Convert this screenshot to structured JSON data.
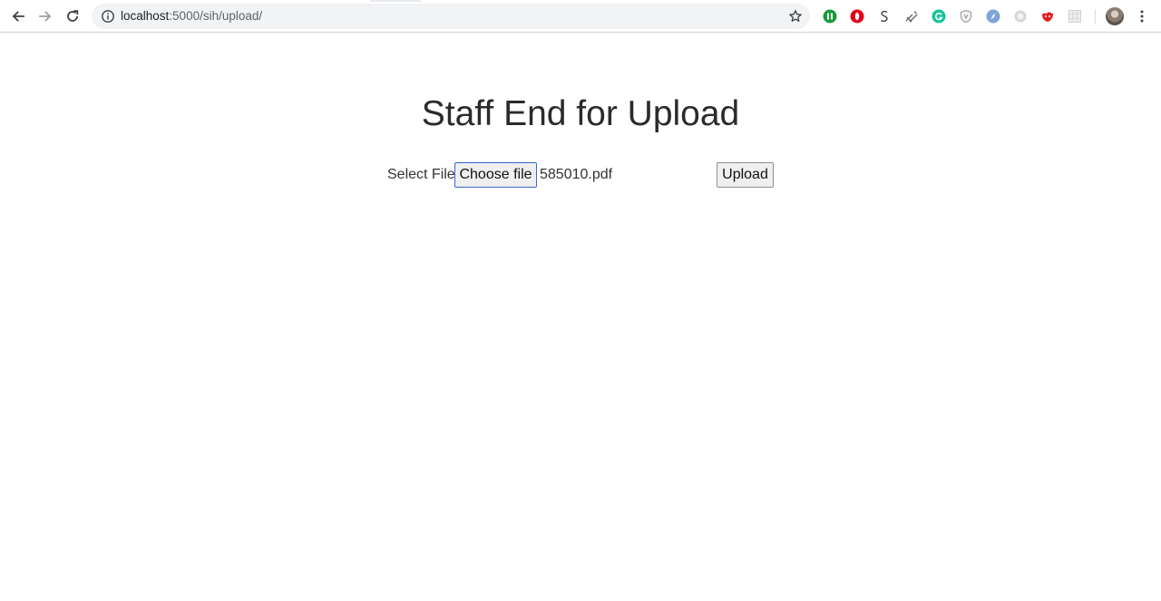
{
  "browser": {
    "url_host": "localhost",
    "url_path": ":5000/sih/upload/",
    "extensions": [
      {
        "icon": "clockify-icon",
        "color": "#1a9a3a"
      },
      {
        "icon": "opera-icon",
        "color": "#e3001b"
      },
      {
        "icon": "s-extension-icon",
        "color": "#333333"
      },
      {
        "icon": "wrench-icon",
        "color": "#5f6368"
      },
      {
        "icon": "grammarly-icon",
        "color": "#15c39a"
      },
      {
        "icon": "shield-icon",
        "color": "#9aa0a6"
      },
      {
        "icon": "compass-icon",
        "color": "#4a78c2"
      },
      {
        "icon": "circle-extension-icon",
        "color": "#b0b0b0"
      },
      {
        "icon": "red-extension-icon",
        "color": "#e02020"
      },
      {
        "icon": "grid-extension-icon",
        "color": "#c9c9c9"
      }
    ]
  },
  "page": {
    "title": "Staff End for Upload",
    "select_label": "Select File",
    "choose_button": "Choose file",
    "file_name": "585010.pdf",
    "upload_button": "Upload"
  }
}
